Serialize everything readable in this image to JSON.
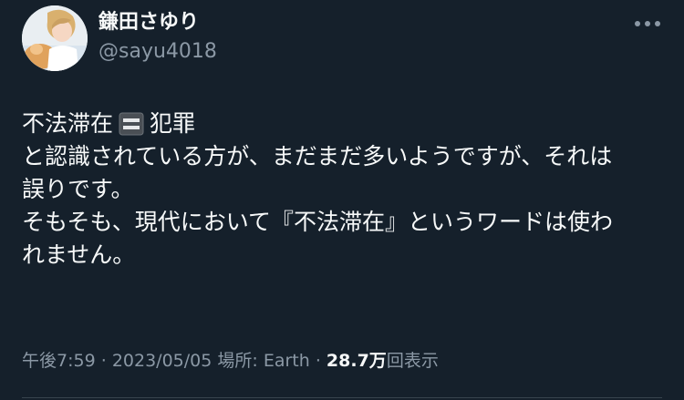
{
  "author": {
    "display_name": "鎌田さゆり",
    "handle": "@sayu4018"
  },
  "tweet": {
    "line1_before": "不法滞在",
    "emoji": "equals-emoji",
    "line1_after": "犯罪",
    "line2": "と認識されている方が、まだまだ多いようですが、それは",
    "line3": "誤りです。",
    "line4": "そもそも、現代において『不法滞在』というワードは使わ",
    "line5": "れません。"
  },
  "meta": {
    "time": "午後7:59",
    "sep1": "·",
    "date": "2023/05/05",
    "location_label": "場所:",
    "location": "Earth",
    "sep2": "·",
    "views_count": "28.7万",
    "views_label": "回表示"
  },
  "colors": {
    "background": "#15202b",
    "text_primary": "#f7f9f9",
    "text_secondary": "#8b98a5",
    "divider": "#38444d"
  },
  "icons": {
    "more": "more-horizontal-icon"
  }
}
